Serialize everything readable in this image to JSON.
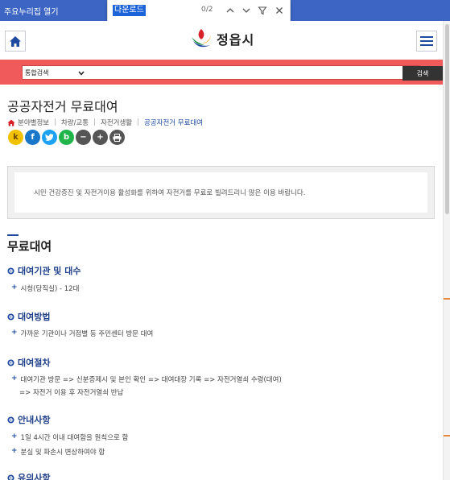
{
  "topbar": {
    "skip_link": "주요누리집 열기",
    "find": {
      "query": "다운로드",
      "count": "0/2"
    }
  },
  "header": {
    "logo_text": "정읍시",
    "home_icon": "home-icon",
    "menu_icon": "hamburger-icon"
  },
  "search": {
    "scope": "통합검색",
    "placeholder": "",
    "button": "검색"
  },
  "page": {
    "title": "공공자전거 무료대여",
    "breadcrumb": [
      "분야별정보",
      "차량/교통",
      "자전거생활",
      "공공자전거 무료대여"
    ]
  },
  "share": [
    {
      "name": "kakaostory",
      "label": "k",
      "color": "#f2c100"
    },
    {
      "name": "facebook",
      "label": "f",
      "color": "#1877c8"
    },
    {
      "name": "twitter",
      "label": "t",
      "color": "#1da1f2"
    },
    {
      "name": "band",
      "label": "b",
      "color": "#20b54a"
    },
    {
      "name": "zoom-out",
      "label": "−",
      "color": "#555555"
    },
    {
      "name": "zoom-in",
      "label": "+",
      "color": "#555555"
    },
    {
      "name": "print",
      "label": "⎙",
      "color": "#555555"
    }
  ],
  "notice": "시민 건강증진 및 자전거이용 활성화를 위하여 자전거를 무료로 빌려드리니 많은 이용 바랍니다.",
  "section": {
    "title": "무료대여",
    "subsections": [
      {
        "title": "대여기관 및 대수",
        "items": [
          "시청(당직실) - 12대"
        ]
      },
      {
        "title": "대여방법",
        "items": [
          "가까운 기관이나 거점별 동 주민센터 방문 대여"
        ]
      },
      {
        "title": "대여절차",
        "items": [
          "대여기관 방문 => 신분증제시 및 본인 확인 => 대여대장 기록 => 자전거열쇠 수령(대여)"
        ],
        "continuation": "=> 자전거 이용 후 자전거열쇠 반납"
      },
      {
        "title": "안내사항",
        "items": [
          "1일 4시간 이내 대여함을 원칙으로 함",
          "분실 및 파손시 변상하여야 함"
        ]
      },
      {
        "title": "유의사항",
        "items": []
      }
    ]
  },
  "colors": {
    "topbar": "#3d66c4",
    "search_band": "#f05a5a",
    "accent": "#1e4aa0"
  }
}
